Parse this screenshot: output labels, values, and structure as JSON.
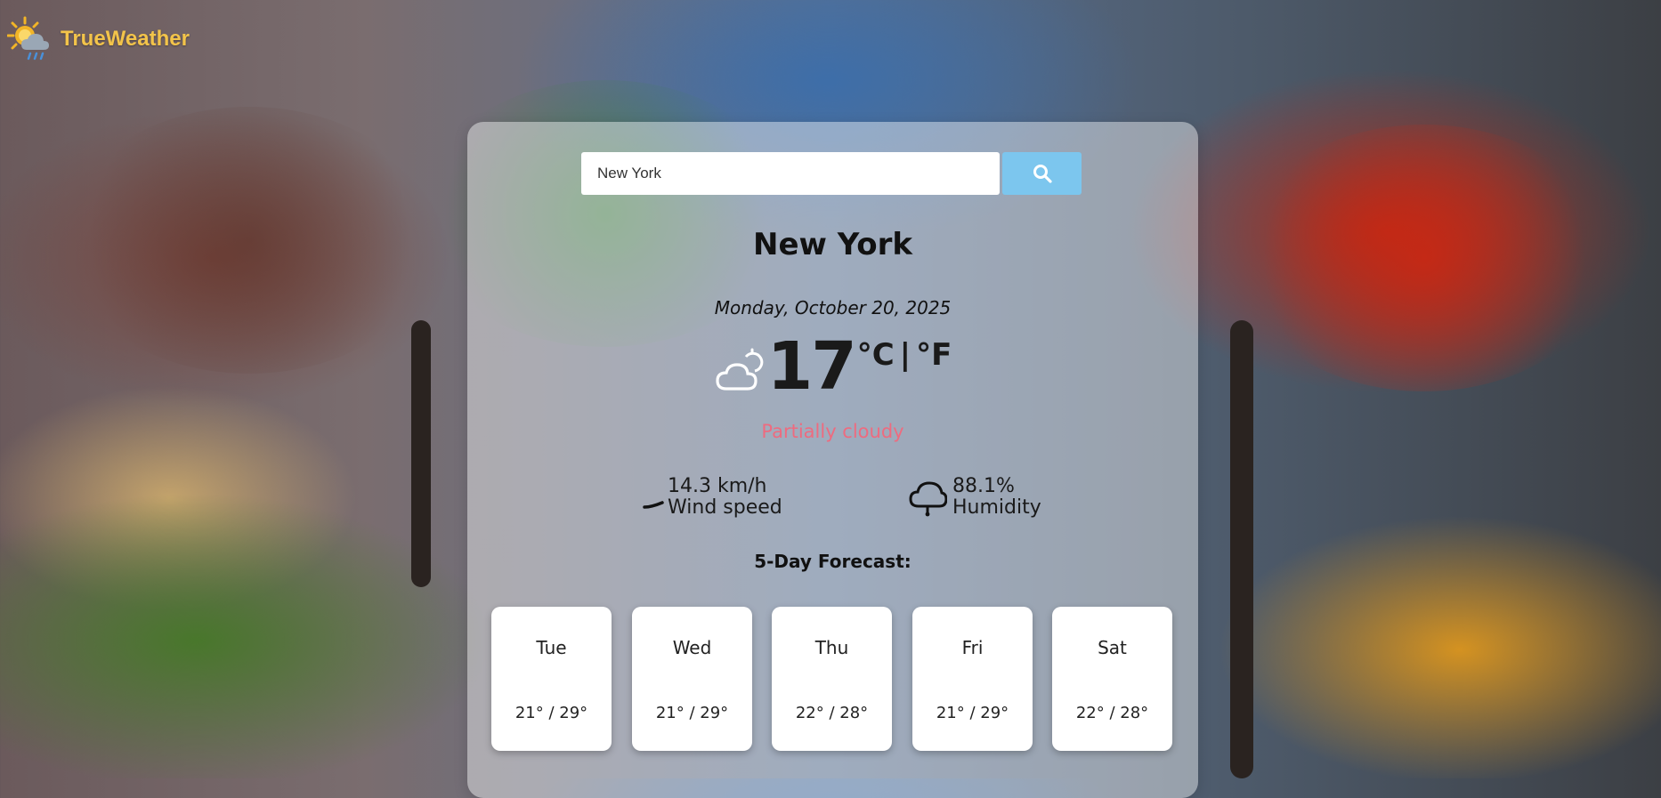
{
  "brand": {
    "name": "TrueWeather",
    "logo_icon": "sun-cloud-rain-icon"
  },
  "search": {
    "value": "New York",
    "button_icon": "search-icon"
  },
  "current": {
    "city": "New York",
    "date": "Monday, October 20, 2025",
    "temperature": "17",
    "unit_c": "°C",
    "unit_sep": "|",
    "unit_f": "°F",
    "condition": "Partially cloudy",
    "condition_icon": "partly-cloudy-icon",
    "condition_color": "#ee6b7f"
  },
  "stats": {
    "wind": {
      "value": "14.3 km/h",
      "label": "Wind speed",
      "icon": "wind-icon"
    },
    "humidity": {
      "value": "88.1%",
      "label": "Humidity",
      "icon": "humidity-cloud-icon"
    }
  },
  "forecast": {
    "title": "5-Day Forecast:",
    "days": [
      {
        "day": "Tue",
        "temps": "21° / 29°"
      },
      {
        "day": "Wed",
        "temps": "21° / 29°"
      },
      {
        "day": "Thu",
        "temps": "22° / 28°"
      },
      {
        "day": "Fri",
        "temps": "21° / 29°"
      },
      {
        "day": "Sat",
        "temps": "22° / 28°"
      }
    ]
  },
  "colors": {
    "brand": "#f3c44a",
    "search_button": "#7cc6ee"
  }
}
